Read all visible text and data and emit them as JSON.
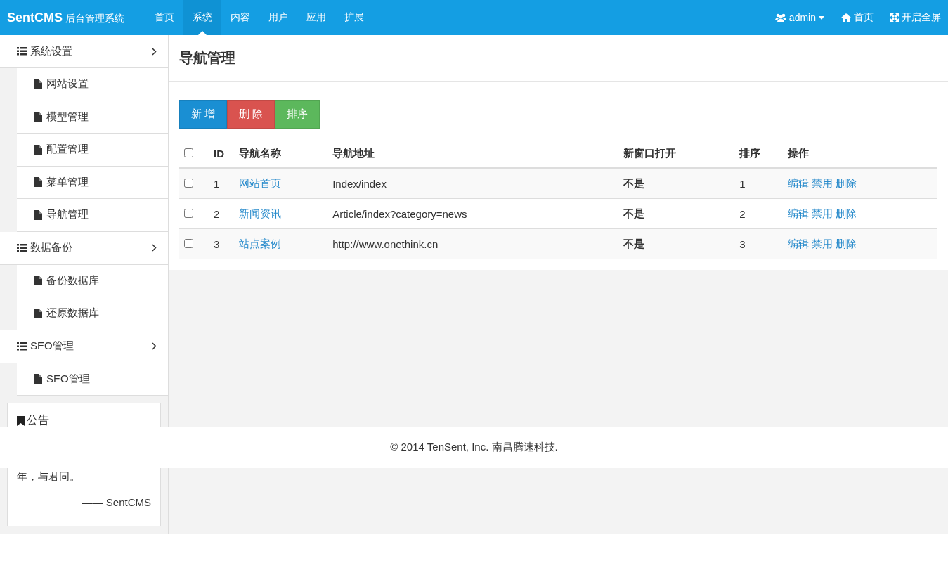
{
  "header": {
    "brand": "SentCMS",
    "subtitle": "后台管理系统",
    "nav": [
      {
        "label": "首页",
        "selected": false
      },
      {
        "label": "系统",
        "selected": true
      },
      {
        "label": "内容",
        "selected": false
      },
      {
        "label": "用户",
        "selected": false
      },
      {
        "label": "应用",
        "selected": false
      },
      {
        "label": "扩展",
        "selected": false
      }
    ],
    "user": "admin",
    "home": "首页",
    "fullscreen": "开启全屏"
  },
  "sidebar": {
    "groups": [
      {
        "title": "系统设置",
        "items": [
          "网站设置",
          "模型管理",
          "配置管理",
          "菜单管理",
          "导航管理"
        ]
      },
      {
        "title": "数据备份",
        "items": [
          "备份数据库",
          "还原数据库"
        ]
      },
      {
        "title": "SEO管理",
        "items": [
          "SEO管理"
        ]
      }
    ],
    "notice": {
      "title": "公告",
      "text": "年，与君同。",
      "signature": "—— SentCMS"
    }
  },
  "page_title": "导航管理",
  "buttons": [
    {
      "label": "新 增",
      "kind": "primary"
    },
    {
      "label": "删 除",
      "kind": "danger"
    },
    {
      "label": "排序",
      "kind": "success"
    }
  ],
  "table": {
    "select_all_checked": false,
    "columns": [
      "ID",
      "导航名称",
      "导航地址",
      "新窗口打开",
      "排序",
      "操作"
    ],
    "rows": [
      {
        "checked": false,
        "id": "1",
        "name": "网站首页",
        "url": "Index/index",
        "new_window": "不是",
        "sort": "1",
        "actions": [
          "编辑",
          "禁用",
          "删除"
        ]
      },
      {
        "checked": false,
        "id": "2",
        "name": "新闻资讯",
        "url": "Article/index?category=news",
        "new_window": "不是",
        "sort": "2",
        "actions": [
          "编辑",
          "禁用",
          "删除"
        ]
      },
      {
        "checked": false,
        "id": "3",
        "name": "站点案例",
        "url": "http://www.onethink.cn",
        "new_window": "不是",
        "sort": "3",
        "actions": [
          "编辑",
          "禁用",
          "删除"
        ]
      }
    ]
  },
  "footer": "© 2014 TenSent, Inc. 南昌腾速科技."
}
